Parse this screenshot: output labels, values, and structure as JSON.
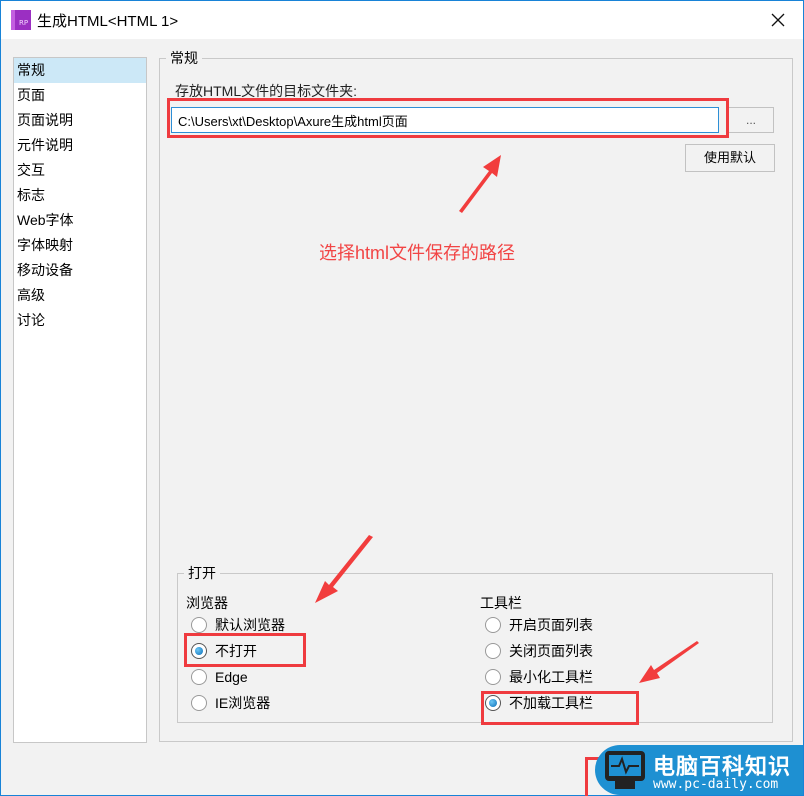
{
  "window": {
    "title": "生成HTML<HTML 1>",
    "app_icon_text": "RP",
    "close_icon": "close-icon"
  },
  "sidebar": {
    "items": [
      {
        "label": "常规",
        "selected": true
      },
      {
        "label": "页面"
      },
      {
        "label": "页面说明"
      },
      {
        "label": "元件说明"
      },
      {
        "label": "交互"
      },
      {
        "label": "标志"
      },
      {
        "label": "Web字体"
      },
      {
        "label": "字体映射"
      },
      {
        "label": "移动设备"
      },
      {
        "label": "高级"
      },
      {
        "label": "讨论"
      }
    ]
  },
  "general": {
    "legend": "常规",
    "path_label": "存放HTML文件的目标文件夹:",
    "path_value": "C:\\Users\\xt\\Desktop\\Axure生成html页面",
    "browse_label": "...",
    "default_label": "使用默认"
  },
  "annotation": {
    "text": "选择html文件保存的路径",
    "color": "#f24545"
  },
  "open": {
    "legend": "打开",
    "browser": {
      "label": "浏览器",
      "options": [
        {
          "label": "默认浏览器",
          "checked": false
        },
        {
          "label": "不打开",
          "checked": true
        },
        {
          "label": "Edge",
          "checked": false
        },
        {
          "label": "IE浏览器",
          "checked": false
        }
      ]
    },
    "toolbar": {
      "label": "工具栏",
      "options": [
        {
          "label": "开启页面列表",
          "checked": false
        },
        {
          "label": "关闭页面列表",
          "checked": false
        },
        {
          "label": "最小化工具栏",
          "checked": false
        },
        {
          "label": "不加载工具栏",
          "checked": true
        }
      ]
    }
  },
  "watermark": {
    "title": "电脑百科知识",
    "url": "www.pc-daily.com"
  },
  "colors": {
    "accent": "#1883d7",
    "highlight": "#ef3b3f",
    "selected_bg": "#cce8f7"
  }
}
